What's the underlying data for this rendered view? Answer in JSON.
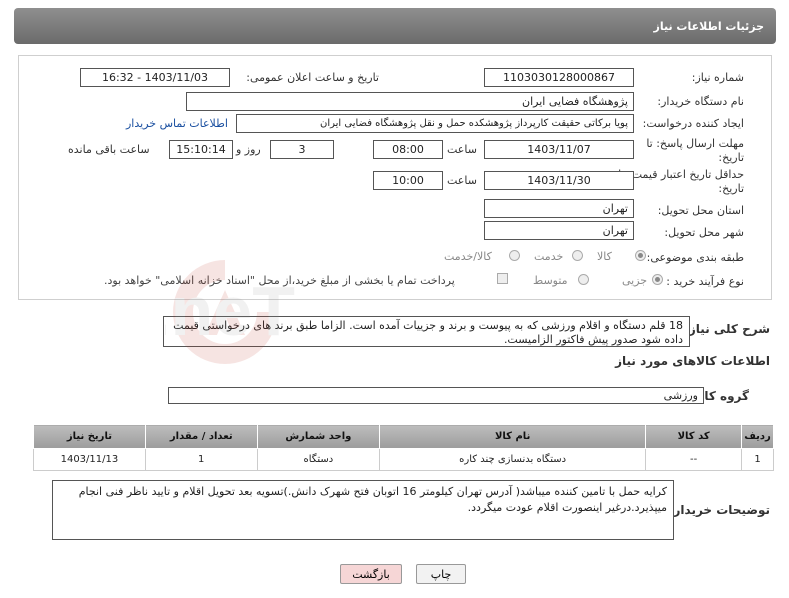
{
  "header": {
    "title": "جزئیات اطلاعات نیاز"
  },
  "form": {
    "need_number": {
      "label": "شماره نیاز:",
      "value": "1103030128000867"
    },
    "announce_datetime": {
      "label": "تاریخ و ساعت اعلان عمومی:",
      "value": "1403/11/03 - 16:32"
    },
    "buyer_org": {
      "label": "نام دستگاه خریدار:",
      "value": "پژوهشگاه فضایی ایران"
    },
    "requester": {
      "label": "ایجاد کننده درخواست:",
      "value": "پویا برکاتی حقیقت کارپرداز پژوهشکده حمل و نقل پژوهشگاه فضایی ایران",
      "contact_link": "اطلاعات تماس خریدار"
    },
    "reply_deadline": {
      "label_line1": "مهلت ارسال پاسخ: تا",
      "label_line2": "تاریخ:",
      "date": "1403/11/07",
      "time_label": "ساعت",
      "time": "08:00",
      "days": "3",
      "days_label": "روز و",
      "remaining": "15:10:14",
      "remaining_label": "ساعت باقی مانده"
    },
    "price_validity": {
      "label_line1": "حداقل تاریخ اعتبار قیمت: تا",
      "label_line2": "تاریخ:",
      "date": "1403/11/30",
      "time_label": "ساعت",
      "time": "10:00"
    },
    "province": {
      "label": "استان محل تحویل:",
      "value": "تهران"
    },
    "city": {
      "label": "شهر محل تحویل:",
      "value": "تهران"
    },
    "category": {
      "label": "طبقه بندی موضوعی:",
      "options": [
        "کالا",
        "خدمت",
        "کالا/خدمت"
      ],
      "selected": "کالا"
    },
    "process": {
      "label": "نوع فرآیند خرید :",
      "options": [
        "جزیی",
        "متوسط"
      ],
      "selected": "جزیی",
      "note": "پرداخت تمام یا بخشی از مبلغ خرید،از محل \"اسناد خزانه اسلامی\" خواهد بود."
    }
  },
  "description": {
    "label": "شرح کلی نیاز:",
    "text": "18 قلم دستگاه و اقلام ورزشی که به پیوست و برند و جزییات آمده است. الزاما طبق برند های درخواستی قیمت داده شود صدور پیش فاکتور الزامیست."
  },
  "goods_info": {
    "title": "اطلاعات کالاهای مورد نیاز",
    "group_label": "گروه کالا:",
    "group_value": "ورزشی",
    "columns": [
      "ردیف",
      "کد کالا",
      "نام کالا",
      "واحد شمارش",
      "تعداد / مقدار",
      "تاریخ نیاز"
    ],
    "rows": [
      [
        "1",
        "--",
        "دستگاه بدنسازی چند کاره",
        "دستگاه",
        "1",
        "1403/11/13"
      ]
    ]
  },
  "buyer_notes": {
    "label": "توضیحات خریدار:",
    "text": "کرایه حمل با تامین کننده میباشد( آدرس تهران کیلومتر 16 اتوبان فتح شهرک دانش.)تسویه بعد تحویل اقلام و تایید ناظر فنی انجام میپذیرد.درغیر اینصورت اقلام عودت میگردد."
  },
  "buttons": {
    "print": "چاپ",
    "back": "بازگشت"
  },
  "watermark": {
    "text": "AriaTender.neT"
  },
  "colors": {
    "header_bg": "#7a7a7a",
    "link": "#1a4fa0",
    "back_button_bg": "#f6d6d6",
    "watermark": "#c0392b"
  }
}
